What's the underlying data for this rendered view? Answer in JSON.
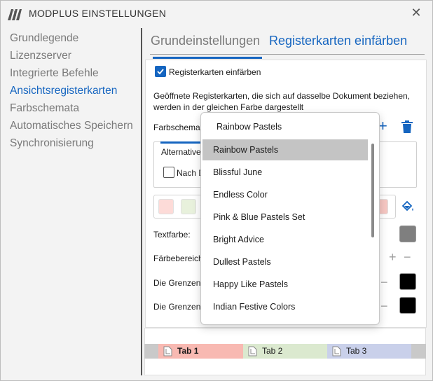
{
  "window": {
    "title": "MODPLUS EINSTELLUNGEN"
  },
  "sidebar": {
    "items": [
      {
        "label": "Grundlegende"
      },
      {
        "label": "Lizenzserver"
      },
      {
        "label": "Integrierte Befehle"
      },
      {
        "label": "Ansichtsregisterkarten"
      },
      {
        "label": "Farbschemata"
      },
      {
        "label": "Automatisches Speichern"
      },
      {
        "label": "Synchronisierung"
      }
    ],
    "active_index": 3
  },
  "tabs": [
    {
      "label": "Grundeinstellungen"
    },
    {
      "label": "Registerkarten einfärben"
    }
  ],
  "panel": {
    "enable_checkbox_label": "Registerkarten einfärben",
    "description_line1": "Geöffnete Registerkarten, die sich auf dasselbe Dokument beziehen,",
    "description_line2": "werden in der gleichen Farbe dargestellt",
    "scheme_label": "Farbschemat",
    "group_tab_label": "Alternative",
    "group_checkbox_label": "Nach D",
    "text_color_label": "Textfarbe:",
    "range_label": "Färbebereich",
    "border_label_1": "Die Grenzen",
    "border_label_2": "Die Grenzen"
  },
  "dropdown": {
    "selected_value": "Rainbow Pastels",
    "options": [
      "Rainbow Pastels",
      "Blissful June",
      "Endless Color",
      "Pink & Blue Pastels Set",
      "Bright Advice",
      "Dullest Pastels",
      "Happy Like Pastels",
      "Indian Festive Colors"
    ],
    "highlighted_index": 0
  },
  "preview_tabs": [
    {
      "label": "Tab 1",
      "color": "#f8b9b2"
    },
    {
      "label": "Tab 2",
      "color": "#dbe9cf"
    },
    {
      "label": "Tab 3",
      "color": "#c9d0ea"
    }
  ],
  "colors": {
    "accent": "#1565c0",
    "text_color_swatch": "#7f7f7f",
    "border_color_1": "#000000",
    "border_color_2": "#000000",
    "swatch_1": "#fddbd8",
    "swatch_2": "#e8f1dc",
    "swatch_end": "#f6c7c2"
  },
  "icons": {
    "logo": "modplus-logo-icon",
    "close": "close-icon",
    "add": "plus-icon",
    "delete": "trash-icon",
    "fill": "paint-bucket-icon",
    "document": "document-icon"
  }
}
